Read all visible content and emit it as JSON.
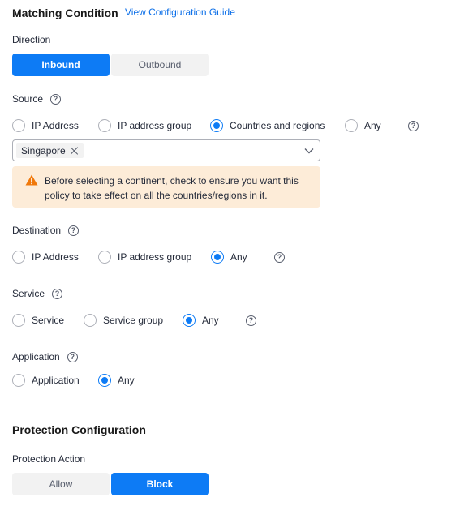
{
  "matching": {
    "title": "Matching Condition",
    "guide_link": "View Configuration Guide"
  },
  "direction": {
    "label": "Direction",
    "options": [
      "Inbound",
      "Outbound"
    ],
    "selected": "Inbound"
  },
  "source": {
    "label": "Source",
    "help": "?",
    "options": [
      "IP Address",
      "IP address group",
      "Countries and regions",
      "Any"
    ],
    "selected": "Countries and regions",
    "tags": [
      "Singapore"
    ],
    "alert": "Before selecting a continent, check to ensure you want this policy to take effect on all the countries/regions in it."
  },
  "destination": {
    "label": "Destination",
    "help": "?",
    "options": [
      "IP Address",
      "IP address group",
      "Any"
    ],
    "selected": "Any"
  },
  "service": {
    "label": "Service",
    "help": "?",
    "options": [
      "Service",
      "Service group",
      "Any"
    ],
    "selected": "Any"
  },
  "application": {
    "label": "Application",
    "help": "?",
    "options": [
      "Application",
      "Any"
    ],
    "selected": "Any"
  },
  "protection": {
    "title": "Protection Configuration",
    "action_label": "Protection Action",
    "options": [
      "Allow",
      "Block"
    ],
    "selected": "Block"
  },
  "colors": {
    "primary": "#0d7bf5",
    "alert_bg": "#fdecd8",
    "warning_icon": "#f0780a"
  },
  "icons": {
    "help": "question-circle-icon",
    "warning": "warning-triangle-icon",
    "tag_close": "close-icon",
    "dropdown": "chevron-down-icon"
  }
}
